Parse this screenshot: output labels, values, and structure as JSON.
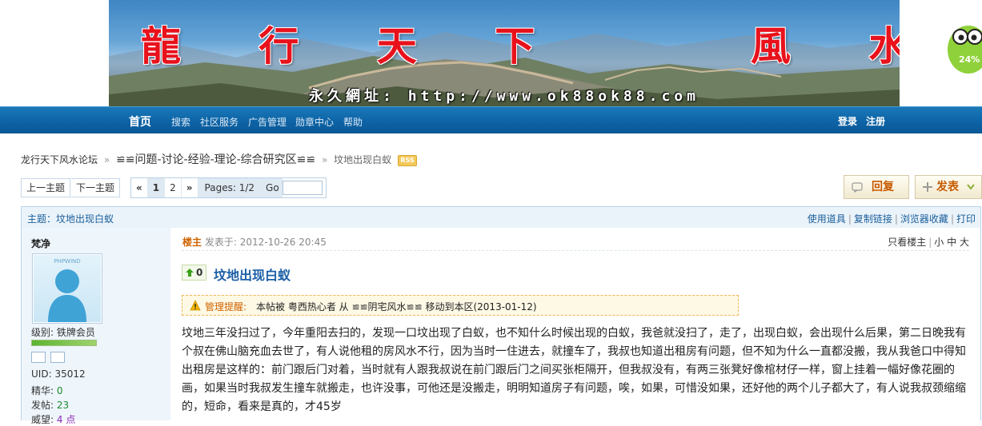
{
  "banner": {
    "title": "龍 行 天 下    風 水 論 壇",
    "url": "永久網址: http://www.ok88ok88.com"
  },
  "mascot": {
    "label": "24%"
  },
  "nav": {
    "home": "首页",
    "items": [
      "搜索",
      "社区服务",
      "广告管理",
      "勋章中心",
      "帮助"
    ],
    "login": "登录",
    "register": "注册"
  },
  "breadcrumb": {
    "site": "龙行天下风水论坛",
    "forum": "≌≌问题-讨论-经验-理论-综合研究区≌≌",
    "current": "坟地出现白蚁",
    "sep": "»",
    "rss": "RSS"
  },
  "topic_nav": {
    "prev": "上一主题",
    "next": "下一主题"
  },
  "pager": {
    "first": "«",
    "pages": [
      "1",
      "2"
    ],
    "last": "»",
    "info": "Pages: 1/2",
    "go": "Go"
  },
  "actions": {
    "reply": "回复",
    "post": "发表"
  },
  "topic_bar": {
    "title": "主题：坟地出现白蚁",
    "tools": [
      "使用道具",
      "复制链接",
      "浏览器收藏",
      "打印"
    ]
  },
  "user": {
    "name": "梵净",
    "avatar_mark": "PHPWIND",
    "level": "级别: 铁牌会员",
    "uid_label": "UID:",
    "uid": "35012",
    "jinghua_label": "精华:",
    "jinghua": "0",
    "posts_label": "发帖:",
    "posts": "23",
    "weiwang_label": "威望:",
    "weiwang": "4 点"
  },
  "post": {
    "owner": "楼主",
    "time": "发表于: 2012-10-26 20:45",
    "opts": [
      "只看楼主",
      "小",
      "中",
      "大"
    ],
    "vote": "0",
    "title": "坟地出现白蚁",
    "notice_label": "管理提醒:",
    "notice_text": "本帖被 粤西热心者 从 ≌≌阴宅风水≌≌ 移动到本区(2013-01-12)",
    "body": "坟地三年没扫过了，今年重阳去扫的，发现一口坟出现了白蚁，也不知什么时候出现的白蚁，我爸就没扫了，走了，出现白蚁，会出现什么后果，第二日晚我有个叔在佛山脑充血去世了，有人说他租的房风水不行，因为当时一住进去，就撞车了，我叔也知道出租房有问题，但不知为什么一直都没搬，我从我爸口中得知出租房是这样的：前门跟后门对着，当时就有人跟我叔说在前门跟后门之间买张柜隔开，但我叔没有，有两三张凳好像棺材仔一样，窗上挂着一幅好像花圈的画，如果当时我叔发生撞车就搬走，也许没事，可他还是没搬走，明明知道房子有问题，唉，如果，可惜没如果，还好他的两个儿子都大了，有人说我叔颈缩缩的，短命，看来是真的，才45岁"
  }
}
